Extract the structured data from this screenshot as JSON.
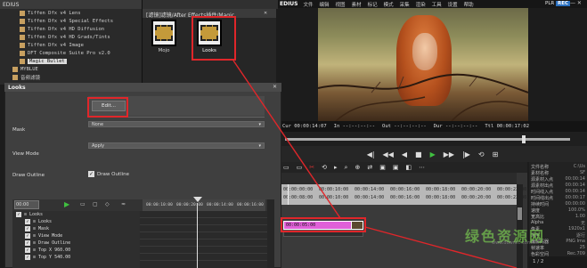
{
  "tree": {
    "title": "EDIUS",
    "items": [
      {
        "label": "Tiffen Dfx v4 Lens"
      },
      {
        "label": "Tiffen Dfx v4 Special Effects"
      },
      {
        "label": "Tiffen Dfx v4 HD Diffusion"
      },
      {
        "label": "Tiffen Dfx v4 HD Grads/Tints"
      },
      {
        "label": "Tiffen Dfx v4 Image"
      },
      {
        "label": "DFT Composite Suite Pro v2.0"
      },
      {
        "label": "Magic Bullet"
      },
      {
        "label": "MYBLUE"
      },
      {
        "label": "音频滤镜"
      }
    ],
    "selected_index": 6
  },
  "bin": {
    "title": "[滤镜]滤镜/After Effects插件/Magic",
    "thumbs": [
      {
        "label": "Mojo"
      },
      {
        "label": "Looks"
      }
    ]
  },
  "topbar": {
    "logo": "EDIUS",
    "menu": [
      "文件",
      "编辑",
      "视图",
      "素材",
      "标记",
      "模式",
      "采集",
      "渲染",
      "工具",
      "设置",
      "帮助"
    ],
    "plr": "PLR",
    "rec": "REC"
  },
  "timecode": {
    "cur": "Cur 00:00:14:07",
    "in": "In --:--:--:--",
    "out": "Out --:--:--:--",
    "dur": "Dur --:--:--:--",
    "ttl": "Ttl 00:00:17:02"
  },
  "scrub": {
    "position": 0.83
  },
  "transport": [
    "◀|",
    "◀◀",
    "◀",
    "■",
    "▶",
    "▶▶",
    "|▶",
    "⟲",
    "⊞"
  ],
  "timeline": {
    "tools": [
      "▭",
      "▭",
      "✂",
      "⟲",
      "▸",
      "⌕",
      "⊕",
      "⇄",
      "▣",
      "▣",
      "◧",
      "⋯"
    ],
    "ruler_ticks": [
      "00:00:00:00",
      "00:00:10:00",
      "00:00:14:00",
      "00:00:16:00",
      "00:00:18:00",
      "00:00:20:00",
      "00:00:22:00"
    ],
    "ruler_ticks_bottom": [
      "00:00:08:00",
      "00:00:10:00",
      "00:00:14:00",
      "00:00:16:00",
      "00:00:18:00",
      "00:00:20:00",
      "00:00:22:00"
    ],
    "clip_label": "00:00:05:00",
    "page": "1 / 2"
  },
  "info": {
    "rows": [
      {
        "k": "文件名称",
        "v": "C:\\Us"
      },
      {
        "k": "素材名称",
        "v": "SF"
      },
      {
        "k": "源素材入点",
        "v": "00:00:14"
      },
      {
        "k": "源素材出点",
        "v": "00:00:14"
      },
      {
        "k": "时间线入点",
        "v": "00:00:14"
      },
      {
        "k": "时间线出点",
        "v": "00:00:17"
      },
      {
        "k": "持续时间",
        "v": "00:00:00"
      },
      {
        "k": "速度",
        "v": "100.0%"
      },
      {
        "k": "宽高比",
        "v": "1.00"
      },
      {
        "k": "Alpha",
        "v": "无"
      },
      {
        "k": "像素",
        "v": "1920x1"
      },
      {
        "k": "场序",
        "v": "逐行"
      },
      {
        "k": "编解码器",
        "v": "PNG Ima"
      },
      {
        "k": "帧速率",
        "v": "25"
      },
      {
        "k": "色彩空间",
        "v": "Rec.709"
      }
    ],
    "footer": "1 / 2"
  },
  "dialog": {
    "title": "Looks",
    "edit_label": "Edit...",
    "mask_label": "Mask",
    "mask_value": "None",
    "viewmode_label": "View Mode",
    "viewmode_value": "Apply",
    "draw_outline_label": "Draw Outline",
    "draw_outline_check_label": "Draw Outline",
    "kf_ruler": [
      "00:00:10:00",
      "00:00:20:00",
      "00:00:14:00",
      "00:00:16:00"
    ],
    "kf_time": "00:00",
    "kf_rows": [
      {
        "label": "Looks",
        "level": 0
      },
      {
        "label": "Looks",
        "level": 1
      },
      {
        "label": "Mask",
        "level": 1
      },
      {
        "label": "View Mode",
        "level": 1
      },
      {
        "label": "Draw Outline",
        "level": 1
      },
      {
        "label": "Top X  960.00",
        "level": 1
      },
      {
        "label": "Top Y  540.00",
        "level": 1
      }
    ]
  },
  "watermark": {
    "text": "绿色资源网",
    "sub": "www.downcc.com"
  },
  "colors": {
    "accent_red": "#e0262a",
    "clip_pink": "#e060d8",
    "play_green": "#40c040",
    "rec_blue": "#2a70c0"
  }
}
